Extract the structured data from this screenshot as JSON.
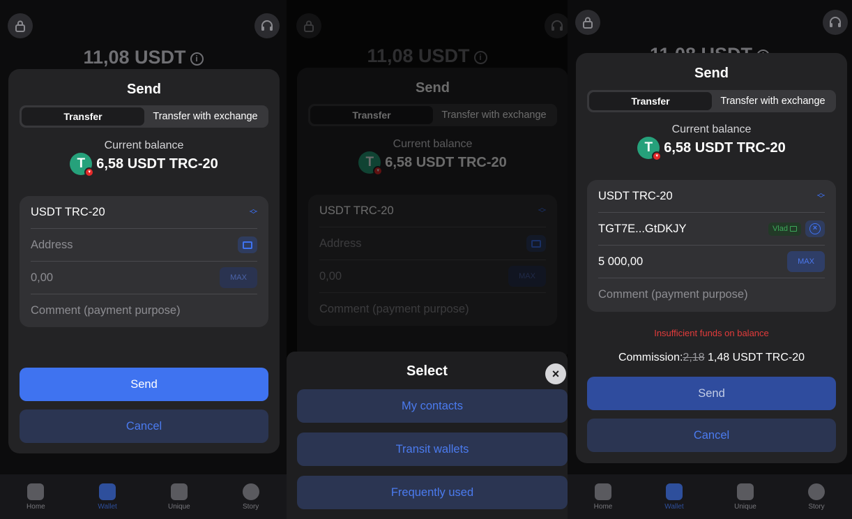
{
  "balance_top": "11,08 USDT",
  "info_glyph": "i",
  "send_title": "Send",
  "tabs": {
    "transfer": "Transfer",
    "transfer_exchange": "Transfer with exchange"
  },
  "current_balance_label": "Current balance",
  "current_balance_value": "6,58 USDT TRC-20",
  "token_glyph": "T",
  "form": {
    "currency": "USDT TRC-20",
    "address_placeholder": "Address",
    "amount_placeholder": "0,00",
    "max_label": "MAX",
    "comment_placeholder": "Comment (payment purpose)"
  },
  "buttons": {
    "send": "Send",
    "cancel": "Cancel"
  },
  "nav": [
    {
      "label": "Home",
      "icon": "home-icon"
    },
    {
      "label": "Wallet",
      "icon": "wallet-icon"
    },
    {
      "label": "Unique",
      "icon": "unique-wallet-icon"
    },
    {
      "label": "Story",
      "icon": "clock-icon"
    }
  ],
  "select_sheet": {
    "title": "Select",
    "close": "×",
    "options": [
      "My contacts",
      "Transit wallets",
      "Frequently used"
    ]
  },
  "filled": {
    "address": "TGT7E...GtDKJY",
    "contact_tag": "Vlad",
    "amount": "5 000,00",
    "clear_glyph": "×",
    "error": "Insufficient funds on balance",
    "commission_label": "Commission:",
    "commission_old": "2,18",
    "commission_new": "1,48 USDT TRC-20"
  },
  "colors": {
    "accent": "#3f73f0",
    "error": "#e23b3b",
    "tether": "#26a17b",
    "tag_green": "#3da85a"
  }
}
